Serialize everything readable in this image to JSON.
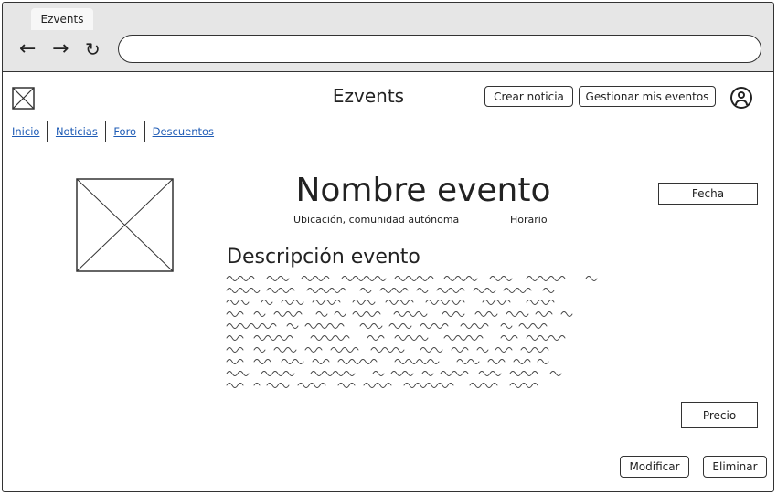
{
  "browser": {
    "tab_title": "Ezvents",
    "url": ""
  },
  "header": {
    "app_title": "Ezvents",
    "create_news_label": "Crear noticia",
    "manage_events_label": "Gestionar mis eventos"
  },
  "nav": {
    "items": [
      "Inicio",
      "Noticias",
      "Foro",
      "Descuentos"
    ]
  },
  "event": {
    "name": "Nombre evento",
    "location": "Ubicación, comunidad autónoma",
    "schedule": "Horario",
    "date_label": "Fecha",
    "description_title": "Descripción evento",
    "price_label": "Precio"
  },
  "actions": {
    "modify_label": "Modificar",
    "delete_label": "Eliminar"
  }
}
